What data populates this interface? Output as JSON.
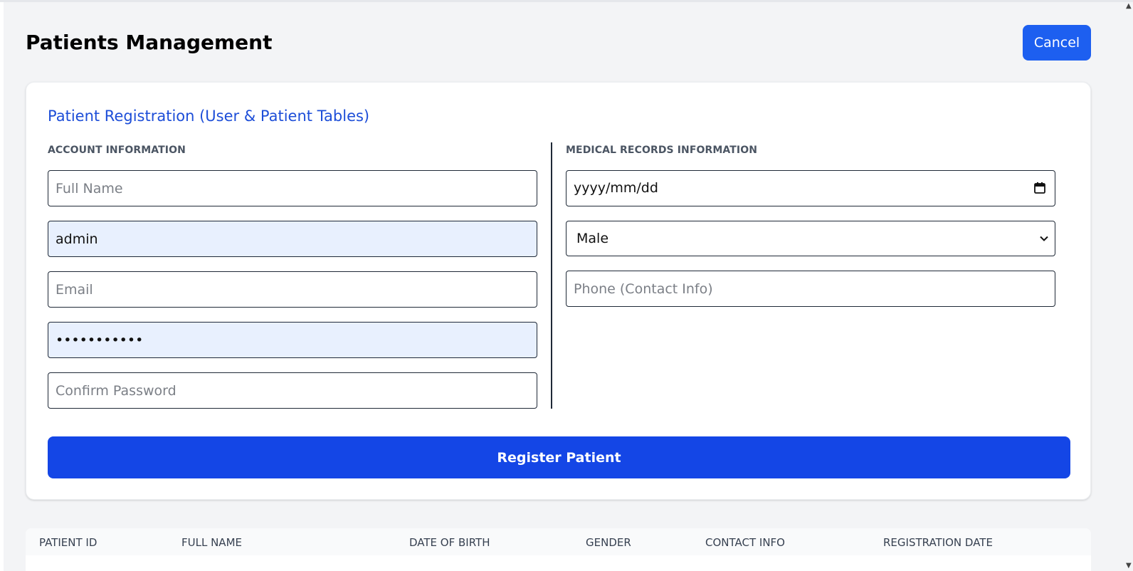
{
  "header": {
    "title": "Patients Management",
    "cancel_label": "Cancel"
  },
  "form": {
    "title": "Patient Registration (User & Patient Tables)",
    "account_section": {
      "label": "ACCOUNT INFORMATION",
      "full_name_placeholder": "Full Name",
      "username_value": "admin",
      "email_placeholder": "Email",
      "password_value": "admin123456",
      "confirm_password_placeholder": "Confirm Password"
    },
    "medical_section": {
      "label": "MEDICAL RECORDS INFORMATION",
      "date_of_birth_placeholder": "yyyy/mm/dd",
      "gender_selected": "Male",
      "phone_placeholder": "Phone (Contact Info)"
    },
    "submit_label": "Register Patient"
  },
  "table": {
    "columns": [
      "PATIENT ID",
      "FULL NAME",
      "DATE OF BIRTH",
      "GENDER",
      "CONTACT INFO",
      "REGISTRATION DATE"
    ]
  },
  "colors": {
    "primary": "#1446e6",
    "cancel": "#1d5ff0",
    "title_blue": "#1d4ed8",
    "autofill_bg": "#e8f0fe",
    "page_bg": "#f3f4f6"
  },
  "icons": {
    "date_picker": "calendar-icon",
    "select_dropdown": "chevron-down-icon"
  }
}
